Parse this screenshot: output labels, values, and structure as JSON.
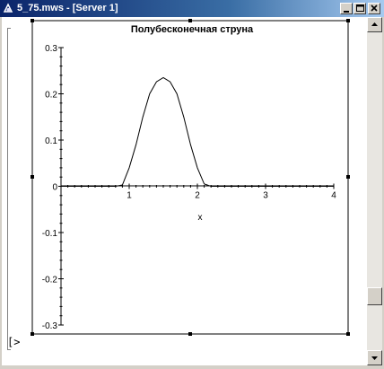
{
  "window": {
    "title": "5_75.mws - [Server 1]"
  },
  "prompt": {
    "symbol": "[>"
  },
  "colors": {
    "titlebar_start": "#0a246a",
    "titlebar_end": "#a6caf0",
    "curve": "#000000"
  },
  "chart_data": {
    "type": "line",
    "title": "Полубесконечная струна",
    "xlabel": "x",
    "ylabel": "",
    "xlim": [
      0,
      4
    ],
    "ylim": [
      -0.3,
      0.3
    ],
    "x_ticks": [
      "1",
      "2",
      "3",
      "4"
    ],
    "y_ticks": [
      "0.3",
      "0.2",
      "0.1",
      "0",
      "-0.1",
      "-0.2",
      "-0.3"
    ],
    "grid": false,
    "series": [
      {
        "x": [
          0,
          0.5,
          0.8,
          0.9,
          1.0,
          1.1,
          1.2,
          1.3,
          1.4,
          1.5,
          1.6,
          1.7,
          1.8,
          1.9,
          2.0,
          2.1,
          2.2,
          2.5,
          3.0,
          3.5,
          4.0
        ],
        "y": [
          0,
          0,
          0,
          0.003,
          0.04,
          0.09,
          0.15,
          0.2,
          0.226,
          0.235,
          0.226,
          0.2,
          0.15,
          0.09,
          0.04,
          0.005,
          0,
          0,
          0,
          0,
          0
        ]
      }
    ]
  }
}
